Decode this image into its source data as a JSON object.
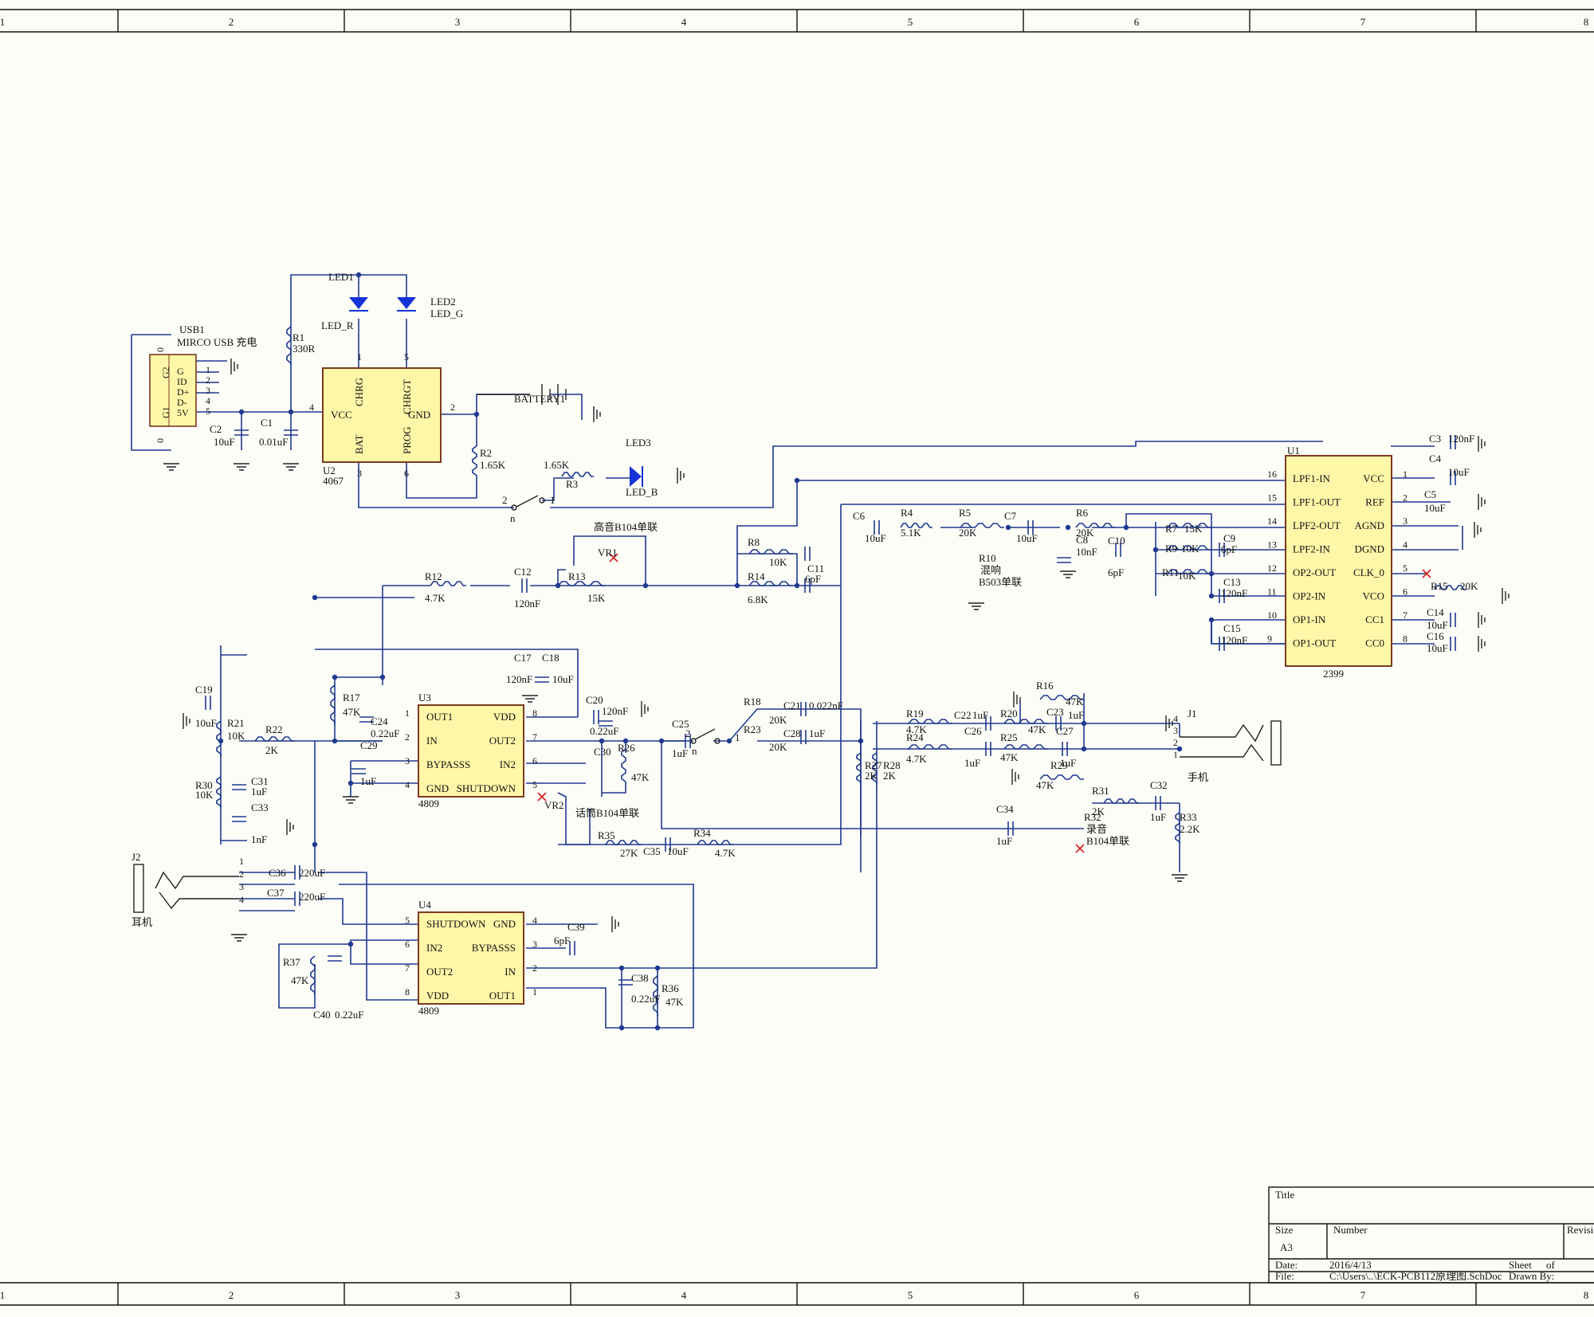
{
  "frame": {
    "columns": [
      "1",
      "2",
      "3",
      "4",
      "5",
      "6",
      "7",
      "8"
    ]
  },
  "title_block": {
    "title_label": "Title",
    "size_label": "Size",
    "size_value": "A3",
    "number_label": "Number",
    "revision_label": "Revisi",
    "date_label": "Date:",
    "date_value": "2016/4/13",
    "sheet_label": "Sheet",
    "of_label": "of",
    "file_label": "File:",
    "file_value": "C:\\Users\\..\\ECK-PCB112原理图.SchDoc",
    "drawn_label": "Drawn By:"
  },
  "colors": {
    "wire": "#1f3a8f",
    "ic_fill": "#fff7a8",
    "ic_border": "#7a3c1f",
    "led": "#1533d6",
    "nc_mark": "#d12020"
  },
  "components": {
    "usb": {
      "ref": "USB1",
      "name": "MIRCO USB 充电",
      "pins": [
        "G",
        "ID",
        "D+",
        "D-",
        "5V"
      ],
      "pin_nums": [
        "1",
        "2",
        "3",
        "4",
        "5"
      ],
      "shell": [
        "G2",
        "G1",
        "0",
        "0"
      ]
    },
    "u2": {
      "ref": "U2",
      "part": "4067",
      "pins": [
        "CHRG",
        "CHRGT",
        "VCC",
        "GND",
        "BAT",
        "PROG"
      ],
      "pin_nums": [
        "1",
        "5",
        "4",
        "2",
        "3",
        "6"
      ]
    },
    "u1": {
      "ref": "U1",
      "part": "2399",
      "left": [
        "LPF1-IN",
        "LPF1-OUT",
        "LPF2-OUT",
        "LPF2-IN",
        "OP2-OUT",
        "OP2-IN",
        "OP1-IN",
        "OP1-OUT"
      ],
      "left_nums": [
        "16",
        "15",
        "14",
        "13",
        "12",
        "11",
        "10",
        "9"
      ],
      "right": [
        "VCC",
        "REF",
        "AGND",
        "DGND",
        "CLK_0",
        "VCO",
        "CC1",
        "CC0"
      ],
      "right_nums": [
        "1",
        "2",
        "3",
        "4",
        "5",
        "6",
        "7",
        "8"
      ]
    },
    "u3": {
      "ref": "U3",
      "part": "4809",
      "left": [
        "OUT1",
        "IN",
        "BYPASSS",
        "GND"
      ],
      "left_nums": [
        "1",
        "2",
        "3",
        "4"
      ],
      "right": [
        "VDD",
        "OUT2",
        "IN2",
        "SHUTDOWN"
      ],
      "right_nums": [
        "8",
        "7",
        "6",
        "5"
      ]
    },
    "u4": {
      "ref": "U4",
      "part": "4809",
      "left": [
        "SHUTDOWN",
        "IN2",
        "OUT2",
        "VDD"
      ],
      "left_nums": [
        "5",
        "6",
        "7",
        "8"
      ],
      "right": [
        "GND",
        "BYPASSS",
        "IN",
        "OUT1"
      ],
      "right_nums": [
        "4",
        "3",
        "2",
        "1"
      ]
    },
    "j1": {
      "ref": "J1",
      "name": "手机",
      "pins": [
        "4",
        "3",
        "2",
        "1"
      ]
    },
    "j2": {
      "ref": "J2",
      "name": "耳机",
      "pins": [
        "1",
        "2",
        "3",
        "4"
      ]
    },
    "switch_num_top": [
      "2",
      "1"
    ]
  },
  "labels": [
    {
      "id": "led1",
      "t": "LED1"
    },
    {
      "id": "led2",
      "t": "LED2"
    },
    {
      "id": "ledr",
      "t": "LED_R"
    },
    {
      "id": "ledg",
      "t": "LED_G"
    },
    {
      "id": "led3",
      "t": "LED3"
    },
    {
      "id": "ledb",
      "t": "LED_B"
    },
    {
      "id": "r1",
      "t": "R1"
    },
    {
      "id": "r1v",
      "t": "330R"
    },
    {
      "id": "c1",
      "t": "C1"
    },
    {
      "id": "c1v",
      "t": "0.01uF"
    },
    {
      "id": "c2",
      "t": "C2"
    },
    {
      "id": "c2v",
      "t": "10uF"
    },
    {
      "id": "r2",
      "t": "R2"
    },
    {
      "id": "r2v",
      "t": "1.65K"
    },
    {
      "id": "bat",
      "t": "BATTERY1"
    },
    {
      "id": "r3v",
      "t": "1.65K"
    },
    {
      "id": "r3",
      "t": "R3"
    },
    {
      "id": "treble",
      "t": "高音B104单联"
    },
    {
      "id": "vr1",
      "t": "VR1"
    },
    {
      "id": "r12",
      "t": "R12"
    },
    {
      "id": "r12v",
      "t": "4.7K"
    },
    {
      "id": "c12",
      "t": "C12"
    },
    {
      "id": "c12v",
      "t": "120nF"
    },
    {
      "id": "r13",
      "t": "R13"
    },
    {
      "id": "r13v",
      "t": "15K"
    },
    {
      "id": "r8",
      "t": "R8"
    },
    {
      "id": "r8v",
      "t": "10K"
    },
    {
      "id": "c11",
      "t": "C11"
    },
    {
      "id": "c11v",
      "t": "6pF"
    },
    {
      "id": "r14",
      "t": "R14"
    },
    {
      "id": "r14v",
      "t": "6.8K"
    },
    {
      "id": "c6",
      "t": "C6"
    },
    {
      "id": "c6v",
      "t": "10uF"
    },
    {
      "id": "r4",
      "t": "R4"
    },
    {
      "id": "r4v",
      "t": "5.1K"
    },
    {
      "id": "r5",
      "t": "R5"
    },
    {
      "id": "r5v",
      "t": "20K"
    },
    {
      "id": "c7",
      "t": "C7"
    },
    {
      "id": "c7v",
      "t": "10uF"
    },
    {
      "id": "r10",
      "t": "R10"
    },
    {
      "id": "reverb",
      "t": "混响"
    },
    {
      "id": "r10v",
      "t": "B503单联"
    },
    {
      "id": "r6",
      "t": "R6"
    },
    {
      "id": "r6v",
      "t": "20K"
    },
    {
      "id": "c8",
      "t": "C8"
    },
    {
      "id": "c8v",
      "t": "10nF"
    },
    {
      "id": "c10",
      "t": "C10"
    },
    {
      "id": "c10v",
      "t": "6pF"
    },
    {
      "id": "r7",
      "t": "R7"
    },
    {
      "id": "r7v",
      "t": "15K"
    },
    {
      "id": "c9",
      "t": "C9"
    },
    {
      "id": "c9v",
      "t": "6pF"
    },
    {
      "id": "r9",
      "t": "R9"
    },
    {
      "id": "r9v",
      "t": "10K"
    },
    {
      "id": "r11",
      "t": "R11"
    },
    {
      "id": "r11v",
      "t": "10K"
    },
    {
      "id": "c13",
      "t": "C13"
    },
    {
      "id": "c13v",
      "t": "120nF"
    },
    {
      "id": "c15",
      "t": "C15"
    },
    {
      "id": "c15v",
      "t": "120nF"
    },
    {
      "id": "c3",
      "t": "C3"
    },
    {
      "id": "c3v",
      "t": "120nF"
    },
    {
      "id": "c4",
      "t": "C4"
    },
    {
      "id": "c4v",
      "t": "10uF"
    },
    {
      "id": "c5",
      "t": "C5"
    },
    {
      "id": "c5v",
      "t": "10uF"
    },
    {
      "id": "r15",
      "t": "R15"
    },
    {
      "id": "r15v",
      "t": "20K"
    },
    {
      "id": "c14",
      "t": "C14"
    },
    {
      "id": "c14v",
      "t": "10uF"
    },
    {
      "id": "c16",
      "t": "C16"
    },
    {
      "id": "c16v",
      "t": "10uF"
    },
    {
      "id": "c19",
      "t": "C19"
    },
    {
      "id": "c19v",
      "t": "10uF"
    },
    {
      "id": "r21",
      "t": "R21"
    },
    {
      "id": "r21v",
      "t": "10K"
    },
    {
      "id": "r22",
      "t": "R22"
    },
    {
      "id": "r22v",
      "t": "2K"
    },
    {
      "id": "r30",
      "t": "R30"
    },
    {
      "id": "r30v",
      "t": "10K"
    },
    {
      "id": "c31",
      "t": "C31"
    },
    {
      "id": "c31v",
      "t": "1uF"
    },
    {
      "id": "c33",
      "t": "C33"
    },
    {
      "id": "c33v",
      "t": "1nF"
    },
    {
      "id": "r17",
      "t": "R17"
    },
    {
      "id": "r17v",
      "t": "47K"
    },
    {
      "id": "c24",
      "t": "C24"
    },
    {
      "id": "c24v",
      "t": "0.22uF"
    },
    {
      "id": "c29",
      "t": "C29"
    },
    {
      "id": "c29v",
      "t": "1uF"
    },
    {
      "id": "c17",
      "t": "C17"
    },
    {
      "id": "c18",
      "t": "C18"
    },
    {
      "id": "c17v",
      "t": "120nF"
    },
    {
      "id": "c18v",
      "t": "10uF"
    },
    {
      "id": "c20",
      "t": "C20"
    },
    {
      "id": "c20v",
      "t": "120nF"
    },
    {
      "id": "c20b",
      "t": "0.22uF"
    },
    {
      "id": "c30",
      "t": "C30"
    },
    {
      "id": "r26",
      "t": "R26"
    },
    {
      "id": "r26v",
      "t": "47K"
    },
    {
      "id": "vr2",
      "t": "VR2"
    },
    {
      "id": "mic",
      "t": "话筒B104单联"
    },
    {
      "id": "c25",
      "t": "C25"
    },
    {
      "id": "c25v",
      "t": "1uF"
    },
    {
      "id": "r18",
      "t": "R18"
    },
    {
      "id": "r18v",
      "t": "20K"
    },
    {
      "id": "c21",
      "t": "C21"
    },
    {
      "id": "c21v",
      "t": "0.022nF"
    },
    {
      "id": "r23",
      "t": "R23"
    },
    {
      "id": "r23v",
      "t": "20K"
    },
    {
      "id": "c28",
      "t": "C28"
    },
    {
      "id": "c28v",
      "t": "1uF"
    },
    {
      "id": "r27",
      "t": "R27"
    },
    {
      "id": "r27v",
      "t": "2K"
    },
    {
      "id": "r28",
      "t": "R28"
    },
    {
      "id": "r28v",
      "t": "2K"
    },
    {
      "id": "r19",
      "t": "R19"
    },
    {
      "id": "r19v",
      "t": "4.7K"
    },
    {
      "id": "c22",
      "t": "C22"
    },
    {
      "id": "c22v",
      "t": "1uF"
    },
    {
      "id": "r20",
      "t": "R20"
    },
    {
      "id": "r20v",
      "t": "47K"
    },
    {
      "id": "r16",
      "t": "R16"
    },
    {
      "id": "r16v",
      "t": "47K"
    },
    {
      "id": "c23",
      "t": "C23"
    },
    {
      "id": "c23v",
      "t": "1uF"
    },
    {
      "id": "r24",
      "t": "R24"
    },
    {
      "id": "r24v",
      "t": "4.7K"
    },
    {
      "id": "c26",
      "t": "C26"
    },
    {
      "id": "c26v",
      "t": "1uF"
    },
    {
      "id": "r25",
      "t": "R25"
    },
    {
      "id": "r25v",
      "t": "47K"
    },
    {
      "id": "c27",
      "t": "C27"
    },
    {
      "id": "c27v",
      "t": "1uF"
    },
    {
      "id": "r29",
      "t": "R29"
    },
    {
      "id": "r29v",
      "t": "47K"
    },
    {
      "id": "r31",
      "t": "R31"
    },
    {
      "id": "r31v",
      "t": "2K"
    },
    {
      "id": "r32",
      "t": "R32"
    },
    {
      "id": "rec",
      "t": "录音"
    },
    {
      "id": "r32v",
      "t": "B104单联"
    },
    {
      "id": "c32",
      "t": "C32"
    },
    {
      "id": "c32v",
      "t": "1uF"
    },
    {
      "id": "r33",
      "t": "R33"
    },
    {
      "id": "r33v",
      "t": "2.2K"
    },
    {
      "id": "c34",
      "t": "C34"
    },
    {
      "id": "c34v",
      "t": "1uF"
    },
    {
      "id": "r35",
      "t": "R35"
    },
    {
      "id": "r35v",
      "t": "27K"
    },
    {
      "id": "c35",
      "t": "C35"
    },
    {
      "id": "c35v",
      "t": "10uF"
    },
    {
      "id": "r34",
      "t": "R34"
    },
    {
      "id": "r34v",
      "t": "4.7K"
    },
    {
      "id": "c36",
      "t": "C36"
    },
    {
      "id": "c36v",
      "t": "220uF"
    },
    {
      "id": "c37",
      "t": "C37"
    },
    {
      "id": "c37v",
      "t": "220uF"
    },
    {
      "id": "c39",
      "t": "C39"
    },
    {
      "id": "c39v",
      "t": "6pF"
    },
    {
      "id": "r37",
      "t": "R37"
    },
    {
      "id": "r37v",
      "t": "47K"
    },
    {
      "id": "c40",
      "t": "C40"
    },
    {
      "id": "c40v",
      "t": "0.22uF"
    },
    {
      "id": "c38",
      "t": "C38"
    },
    {
      "id": "c38v",
      "t": "0.22uF"
    },
    {
      "id": "r36",
      "t": "R36"
    },
    {
      "id": "r36v",
      "t": "47K"
    },
    {
      "id": "sw1a",
      "t": "2"
    },
    {
      "id": "sw1b",
      "t": "1"
    },
    {
      "id": "sw1c",
      "t": "n"
    },
    {
      "id": "sw2a",
      "t": "2"
    },
    {
      "id": "sw2b",
      "t": "1"
    },
    {
      "id": "sw2c",
      "t": "n"
    },
    {
      "id": "u1p",
      "t": "2399"
    }
  ]
}
